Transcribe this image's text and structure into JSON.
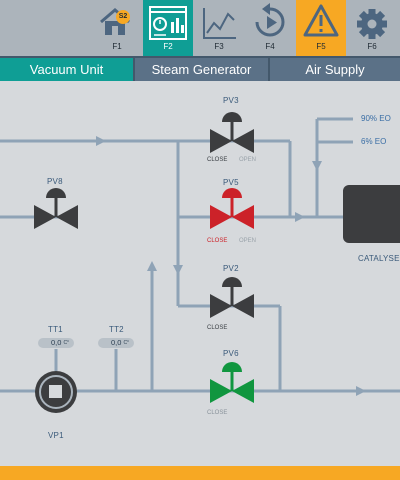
{
  "toolbar": {
    "keys": [
      {
        "label": "F1",
        "icon": "home-icon",
        "badge": "S2"
      },
      {
        "label": "F2",
        "icon": "dashboard-icon"
      },
      {
        "label": "F3",
        "icon": "trend-chart-icon"
      },
      {
        "label": "F4",
        "icon": "replay-icon"
      },
      {
        "label": "F5",
        "icon": "warning-icon"
      },
      {
        "label": "F6",
        "icon": "gear-icon"
      }
    ]
  },
  "tabs": [
    {
      "label": "Vacuum Unit",
      "active": true
    },
    {
      "label": "Steam Generator",
      "active": false
    },
    {
      "label": "Air Supply",
      "active": false
    }
  ],
  "valves": {
    "pv3": {
      "name": "PV3",
      "close": "CLOSE",
      "open": "OPEN",
      "color": "#3c3d3f"
    },
    "pv5": {
      "name": "PV5",
      "close": "CLOSE",
      "open": "OPEN",
      "color": "#cc2229"
    },
    "pv2": {
      "name": "PV2",
      "close": "CLOSE",
      "color": "#3c3d3f"
    },
    "pv6": {
      "name": "PV6",
      "close": "CLOSE",
      "color": "#10963f"
    },
    "pv8": {
      "name": "PV8",
      "color": "#3c3d3f"
    }
  },
  "sensors": {
    "tt1": {
      "name": "TT1",
      "value": "0,0",
      "unit": "C°"
    },
    "tt2": {
      "name": "TT2",
      "value": "0,0",
      "unit": "C°"
    }
  },
  "pump": {
    "name": "VP1"
  },
  "lines": {
    "eo90": "90% EO",
    "eo6": "6% EO"
  },
  "catalyser": {
    "name": "CATALYSE"
  },
  "colors": {
    "pipe": "#8fa3b6",
    "accent": "#0f9e95",
    "warning": "#f7a823"
  }
}
